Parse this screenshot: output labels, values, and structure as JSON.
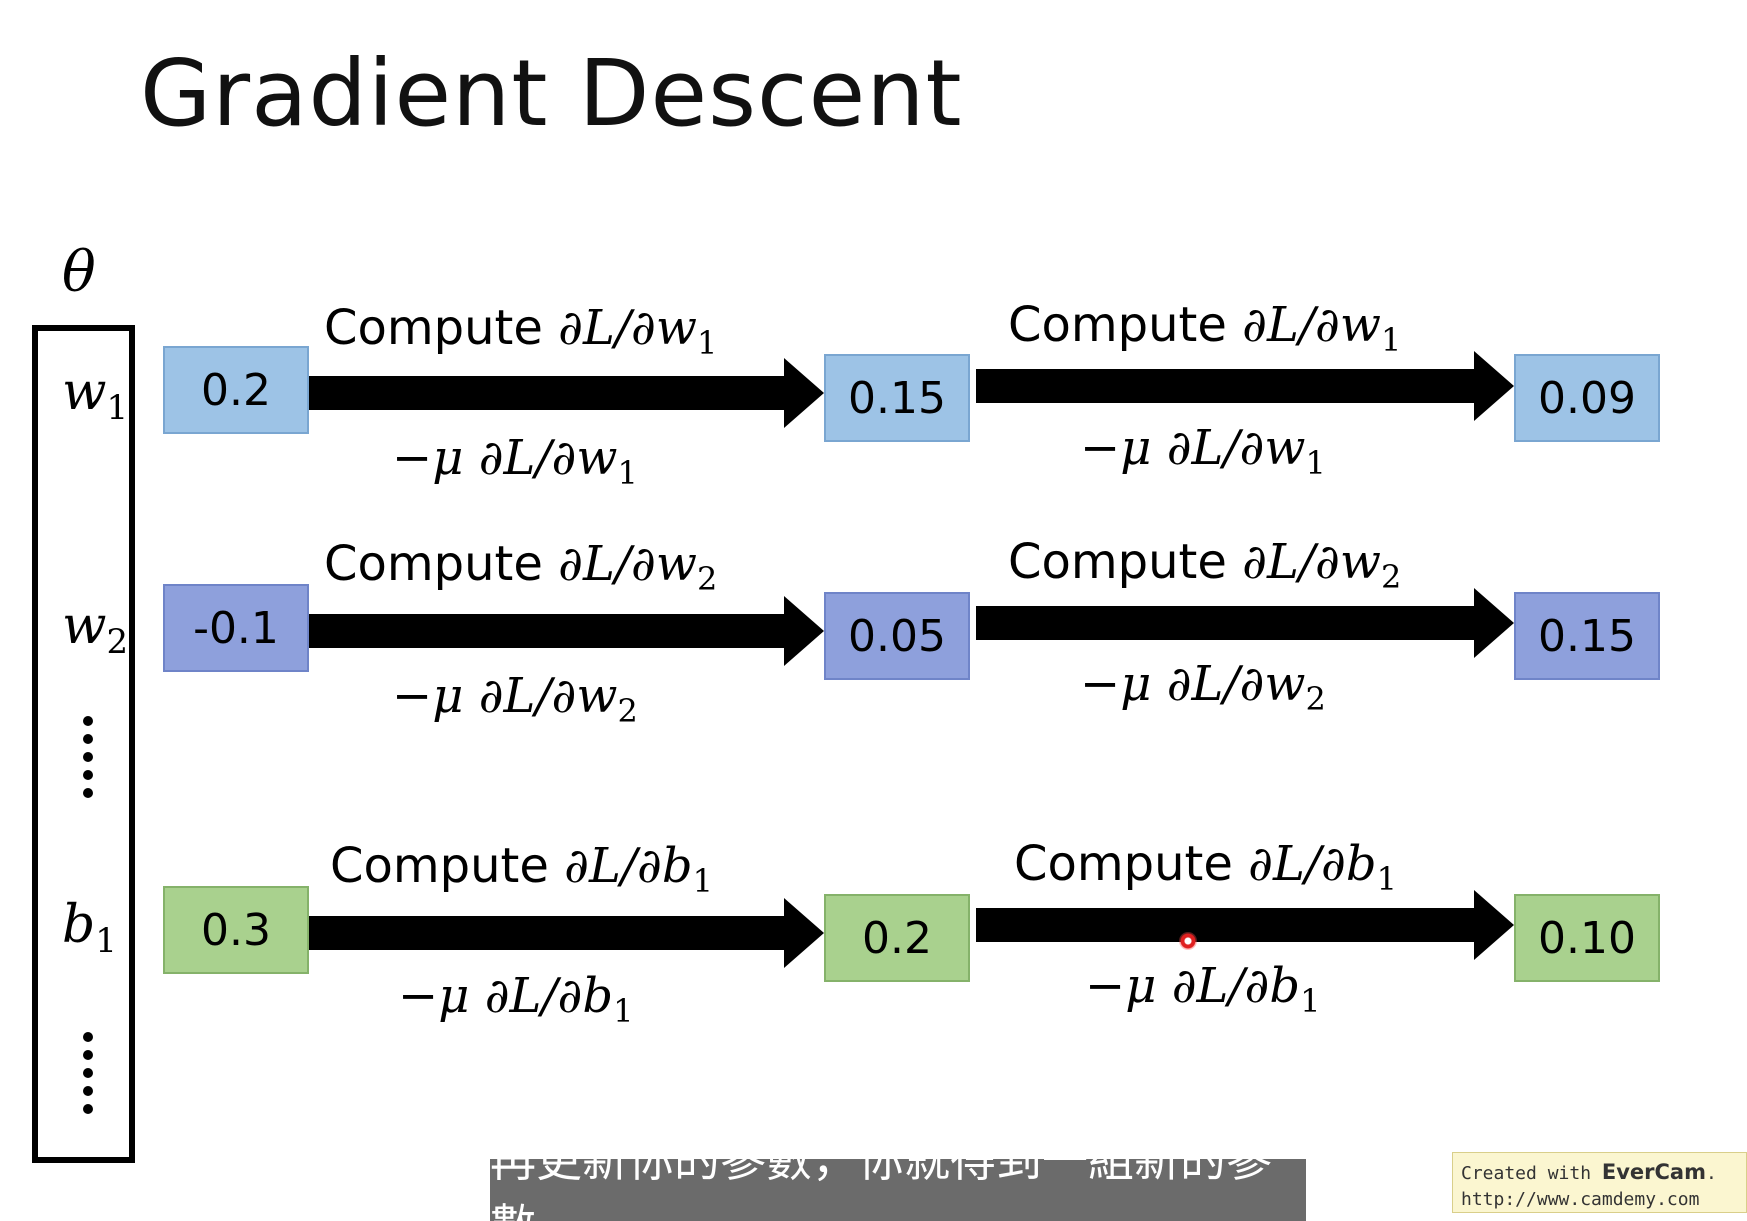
{
  "title": "Gradient Descent",
  "vector": {
    "theta": "θ",
    "vars": [
      {
        "base": "w",
        "sub": "1"
      },
      {
        "base": "w",
        "sub": "2"
      },
      {
        "base": "b",
        "sub": "1"
      }
    ]
  },
  "rows": [
    {
      "param": "w",
      "sub": "1",
      "values": [
        "0.2",
        "0.15",
        "0.09"
      ],
      "compute_word": "Compute",
      "mu_sign": "−μ",
      "color": "#9dc3e6"
    },
    {
      "param": "w",
      "sub": "2",
      "values": [
        "-0.1",
        "0.05",
        "0.15"
      ],
      "compute_word": "Compute",
      "mu_sign": "−μ",
      "color": "#8ea0dc"
    },
    {
      "param": "b",
      "sub": "1",
      "values": [
        "0.3",
        "0.2",
        "0.10"
      ],
      "compute_word": "Compute",
      "mu_sign": "−μ",
      "color": "#a9d18e"
    }
  ],
  "partial": "∂L/∂",
  "subtitle": "再更新你的參數，你就得到一組新的參數",
  "watermark": {
    "prefix": "Created with ",
    "brand": "EverCam",
    "suffix": ".",
    "url": "http://www.camdemy.com"
  }
}
